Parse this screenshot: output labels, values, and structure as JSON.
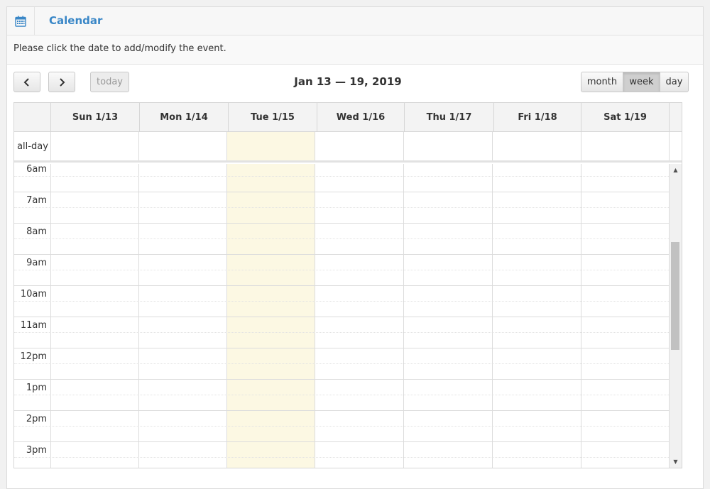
{
  "header": {
    "title": "Calendar",
    "icon": "calendar-icon"
  },
  "notice": "Please click the date to add/modify the event.",
  "toolbar": {
    "prev_icon": "chevron-left-icon",
    "next_icon": "chevron-right-icon",
    "today_label": "today",
    "range_title": "Jan 13 — 19, 2019",
    "views": [
      {
        "label": "month",
        "active": false
      },
      {
        "label": "week",
        "active": true
      },
      {
        "label": "day",
        "active": false
      }
    ]
  },
  "week": {
    "days": [
      "Sun 1/13",
      "Mon 1/14",
      "Tue 1/15",
      "Wed 1/16",
      "Thu 1/17",
      "Fri 1/18",
      "Sat 1/19"
    ],
    "today_index": 2,
    "allday_label": "all-day",
    "hours": [
      "6am",
      "7am",
      "8am",
      "9am",
      "10am",
      "11am",
      "12pm",
      "1pm",
      "2pm",
      "3pm"
    ]
  },
  "colors": {
    "accent": "#3a87c7",
    "today": "#fcf8e3"
  }
}
